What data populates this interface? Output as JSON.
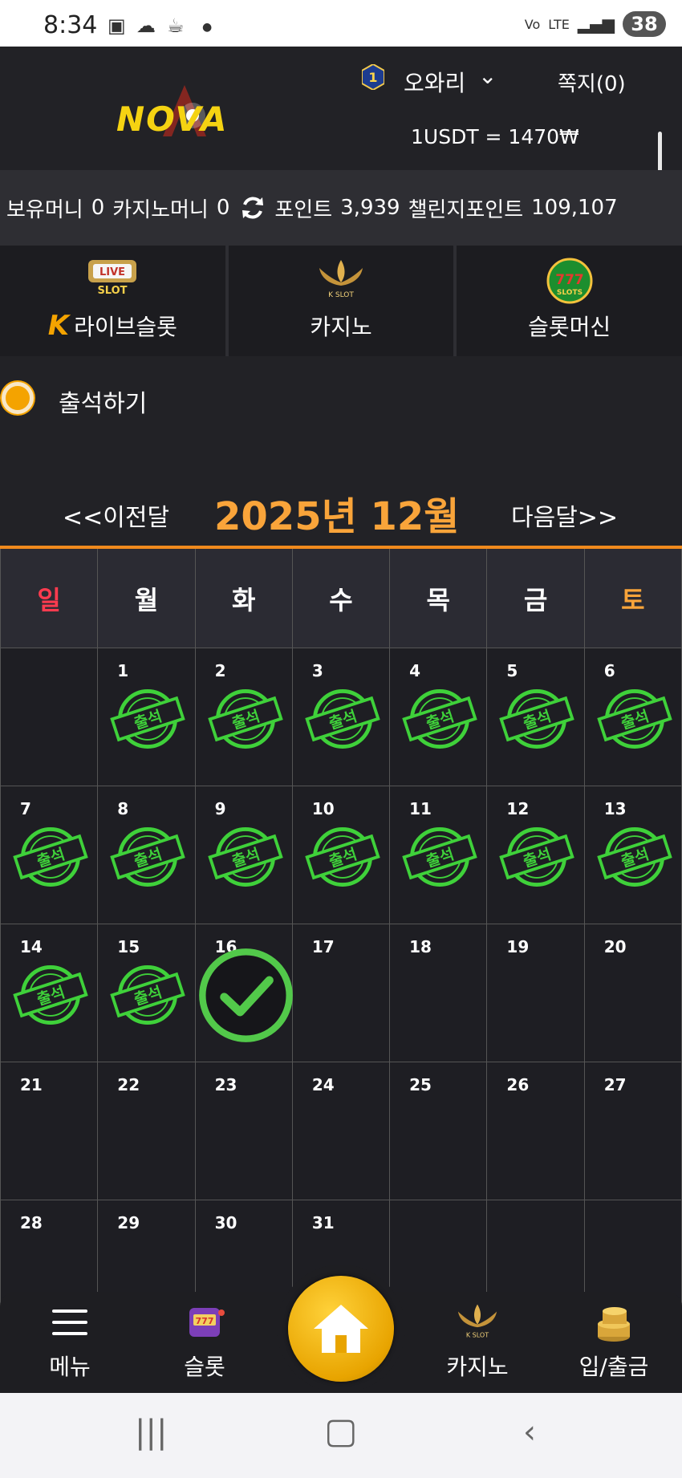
{
  "status_bar": {
    "time": "8:34",
    "network": "LTE",
    "battery": "38"
  },
  "header": {
    "logo_text": "NOVA",
    "rank": "1",
    "username": "오와리",
    "messages": "쪽지(0)",
    "rate": "1USDT = 1470₩"
  },
  "balance": {
    "money_label": "보유머니",
    "money": "0",
    "casino_label": "카지노머니",
    "casino": "0",
    "point_label": "포인트",
    "point": "3,939",
    "challenge_label": "챌린지포인트",
    "challenge": "109,107"
  },
  "tabs": [
    {
      "label": "라이브슬롯",
      "prefix": "K",
      "icon": "live-slot-icon"
    },
    {
      "label": "카지노",
      "icon": "k-slot-icon"
    },
    {
      "label": "슬롯머신",
      "icon": "777-slots-icon"
    }
  ],
  "attendance": {
    "title": "출석하기",
    "prev": "<<이전달",
    "month": "2025년 12월",
    "next": "다음달>>"
  },
  "calendar": {
    "weekdays": [
      "일",
      "월",
      "화",
      "수",
      "목",
      "금",
      "토"
    ],
    "stamp_text": "출석",
    "days": [
      {
        "d": "",
        "s": "none"
      },
      {
        "d": "1",
        "s": "stamp"
      },
      {
        "d": "2",
        "s": "stamp"
      },
      {
        "d": "3",
        "s": "stamp"
      },
      {
        "d": "4",
        "s": "stamp"
      },
      {
        "d": "5",
        "s": "stamp"
      },
      {
        "d": "6",
        "s": "stamp"
      },
      {
        "d": "7",
        "s": "stamp"
      },
      {
        "d": "8",
        "s": "stamp"
      },
      {
        "d": "9",
        "s": "stamp"
      },
      {
        "d": "10",
        "s": "stamp"
      },
      {
        "d": "11",
        "s": "stamp"
      },
      {
        "d": "12",
        "s": "stamp"
      },
      {
        "d": "13",
        "s": "stamp"
      },
      {
        "d": "14",
        "s": "stamp"
      },
      {
        "d": "15",
        "s": "stamp"
      },
      {
        "d": "16",
        "s": "check"
      },
      {
        "d": "17",
        "s": "none"
      },
      {
        "d": "18",
        "s": "none"
      },
      {
        "d": "19",
        "s": "none"
      },
      {
        "d": "20",
        "s": "none"
      },
      {
        "d": "21",
        "s": "none"
      },
      {
        "d": "22",
        "s": "none"
      },
      {
        "d": "23",
        "s": "none"
      },
      {
        "d": "24",
        "s": "none"
      },
      {
        "d": "25",
        "s": "none"
      },
      {
        "d": "26",
        "s": "none"
      },
      {
        "d": "27",
        "s": "none"
      },
      {
        "d": "28",
        "s": "none"
      },
      {
        "d": "29",
        "s": "none"
      },
      {
        "d": "30",
        "s": "none"
      },
      {
        "d": "31",
        "s": "none"
      },
      {
        "d": "",
        "s": "none"
      },
      {
        "d": "",
        "s": "none"
      },
      {
        "d": "",
        "s": "none"
      }
    ]
  },
  "bottom_nav": {
    "menu": "메뉴",
    "slot": "슬롯",
    "casino": "카지노",
    "bank": "입/출금"
  },
  "colors": {
    "accent": "#f9a43a",
    "stamp": "#3fd13a",
    "sunday": "#ff3b4f",
    "saturday": "#f9a43a"
  }
}
